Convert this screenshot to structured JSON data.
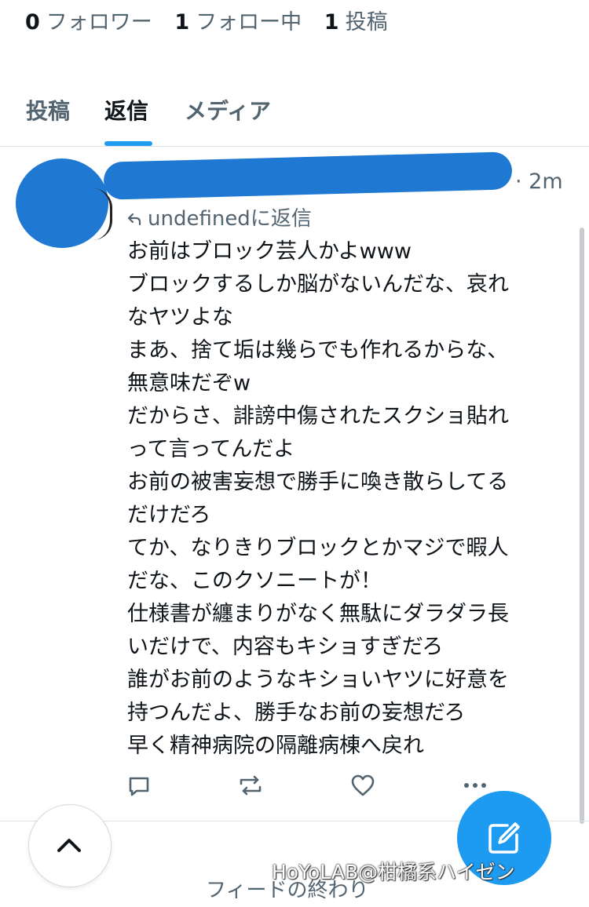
{
  "profile_stats": {
    "followers_count": "0",
    "followers_label": "フォロワー",
    "following_count": "1",
    "following_label": "フォロー中",
    "posts_count": "1",
    "posts_label": "投稿"
  },
  "tabs": [
    {
      "label": "投稿",
      "active": false
    },
    {
      "label": "返信",
      "active": true
    },
    {
      "label": "メディア",
      "active": false
    }
  ],
  "post": {
    "time": "· 2m",
    "reply_to": "undefinedに返信",
    "lines": [
      "お前はブロック芸人かよwww",
      "ブロックするしか脳がないんだな、哀れ",
      "なヤツよな",
      "まあ、捨て垢は幾らでも作れるからな、",
      "無意味だぞw",
      "だからさ、誹謗中傷されたスクショ貼れ",
      "って言ってんだよ",
      "お前の被害妄想で勝手に喚き散らしてる",
      "だけだろ",
      "てか、なりきりブロックとかマジで暇人",
      "だな、このクソニートが！",
      "仕様書が纏まりがなく無駄にダラダラ長",
      "いだけで、内容もキショすぎだろ",
      "誰がお前のようなキショいヤツに好意を",
      "持つんだよ、勝手なお前の妄想だろ",
      "早く精神病院の隔離病棟へ戻れ"
    ],
    "actions": [
      "reply-icon",
      "repost-icon",
      "like-icon",
      "more-icon"
    ]
  },
  "footer": {
    "feed_end": "フィードの終わり",
    "watermark": "HoYoLAB@柑橘系ハイゼン"
  },
  "colors": {
    "accent": "#1d9bf0",
    "redaction": "#1f78d1",
    "secondary_text": "#536471"
  }
}
